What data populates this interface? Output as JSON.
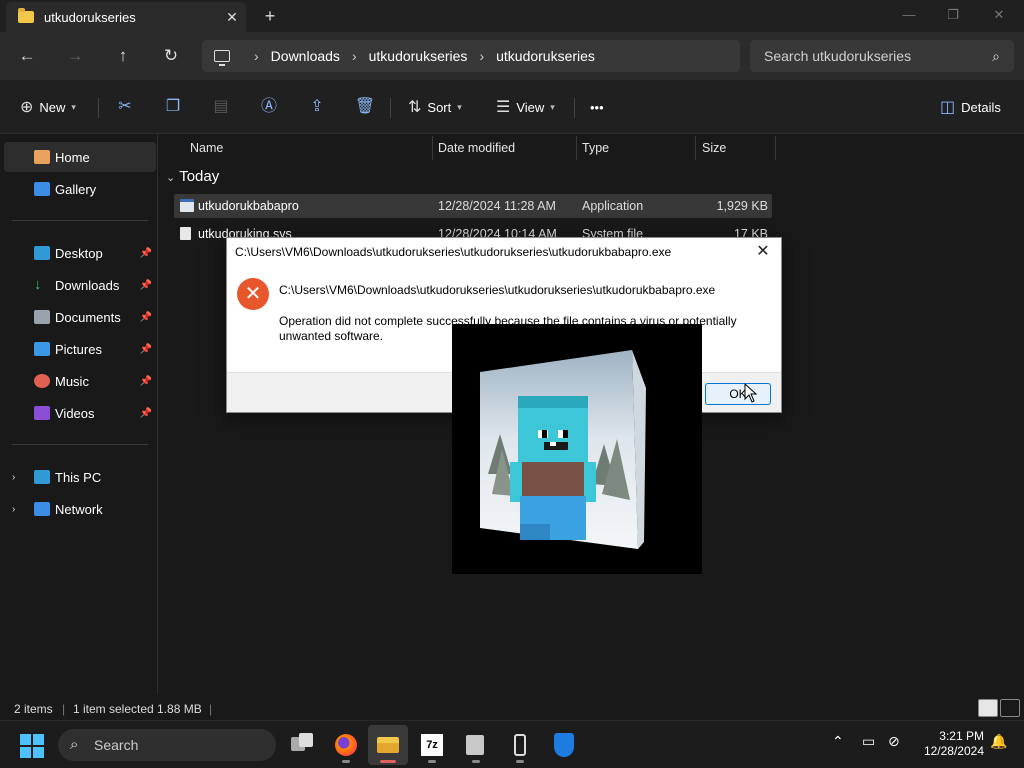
{
  "titlebar": {
    "tab_title": "utkudorukseries",
    "new_tab": "+",
    "close": "✕",
    "minimize": "—",
    "maximize": "❐",
    "window_close": "✕"
  },
  "address": {
    "crumbs": [
      "Downloads",
      "utkudorukseries",
      "utkudorukseries"
    ],
    "search_placeholder": "Search utkudorukseries"
  },
  "commands": {
    "new": "New",
    "sort": "Sort",
    "view": "View",
    "more": "•••",
    "details": "Details"
  },
  "sidebar": {
    "items": [
      {
        "label": "Home"
      },
      {
        "label": "Gallery"
      },
      {
        "label": "Desktop"
      },
      {
        "label": "Downloads"
      },
      {
        "label": "Documents"
      },
      {
        "label": "Pictures"
      },
      {
        "label": "Music"
      },
      {
        "label": "Videos"
      },
      {
        "label": "This PC"
      },
      {
        "label": "Network"
      }
    ]
  },
  "columns": {
    "name": "Name",
    "date": "Date modified",
    "type": "Type",
    "size": "Size"
  },
  "group_label": "Today",
  "files": [
    {
      "name": "utkudorukbabapro",
      "date": "12/28/2024 11:28 AM",
      "type": "Application",
      "size": "1,929 KB"
    },
    {
      "name": "utkudoruking.sys",
      "date": "12/28/2024 10:14 AM",
      "type": "System file",
      "size": "17 KB"
    }
  ],
  "status": {
    "items": "2 items",
    "selected": "1 item selected  1.88 MB"
  },
  "dialog": {
    "title": "C:\\Users\\VM6\\Downloads\\utkudorukseries\\utkudorukseries\\utkudorukbabapro.exe",
    "path": "C:\\Users\\VM6\\Downloads\\utkudorukseries\\utkudorukseries\\utkudorukbabapro.exe",
    "message": "Operation did not complete successfully because the file contains a virus or potentially unwanted software.",
    "ok": "OK"
  },
  "taskbar": {
    "search": "Search",
    "time": "3:21 PM",
    "date": "12/28/2024",
    "app_7z": "7z"
  },
  "colors": {
    "accent": "#4cc2ff",
    "error": "#e8572c",
    "folder": "#f2c84b"
  }
}
